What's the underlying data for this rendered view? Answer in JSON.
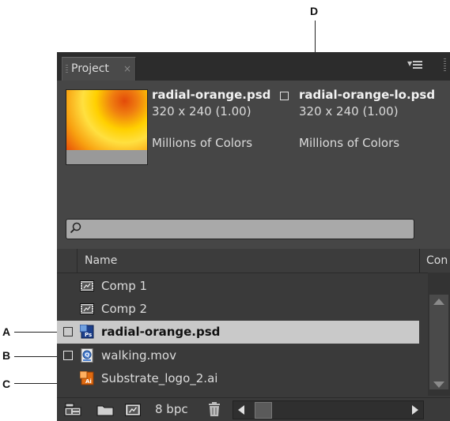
{
  "callouts": {
    "a": "A",
    "b": "B",
    "c": "C",
    "d": "D"
  },
  "panel": {
    "tab_label": "Project",
    "tab_close": "×"
  },
  "preview": {
    "file1_name": "radial-orange.psd",
    "file1_dims": "320 x 240 (1.00)",
    "file1_colors": "Millions of Colors",
    "file2_name": "radial-orange-lo.psd",
    "file2_dims": "320 x 240 (1.00)",
    "file2_colors": "Millions of Colors"
  },
  "search": {
    "value": ""
  },
  "columns": {
    "name": "Name",
    "comment": "Con"
  },
  "items": [
    {
      "label": "Comp 1",
      "icon": "composition-icon"
    },
    {
      "label": "Comp 2",
      "icon": "composition-icon"
    },
    {
      "label": "radial-orange.psd",
      "icon": "photoshop-file-icon",
      "selected": true
    },
    {
      "label": "walking.mov",
      "icon": "quicktime-file-icon"
    },
    {
      "label": "Substrate_logo_2.ai",
      "icon": "illustrator-file-icon"
    }
  ],
  "toolbar": {
    "bpc_label": "8 bpc"
  },
  "colors": {
    "panel_bg": "#3a3a3a",
    "selection": "#c9c9c9",
    "text": "#dcdcdc"
  }
}
